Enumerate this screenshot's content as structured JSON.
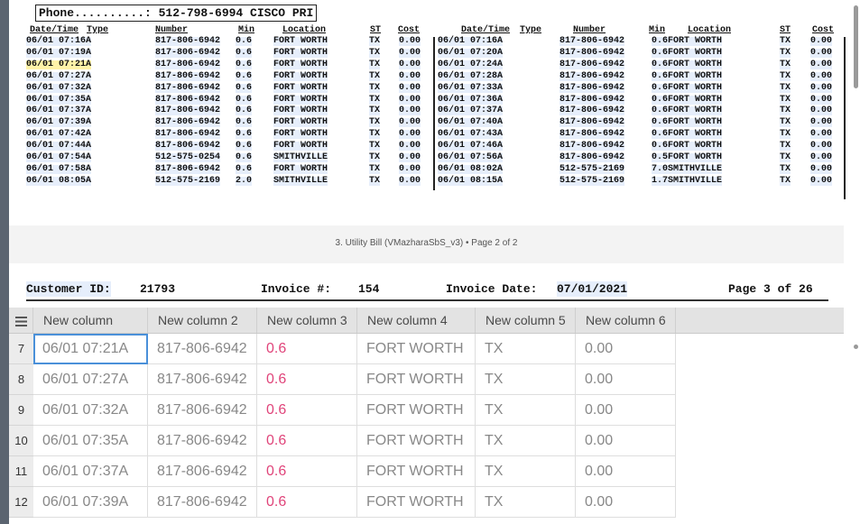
{
  "phone_label": "Phone..........: 512-798-6994 CISCO PRI",
  "headers": {
    "datetime": "Date/Time",
    "type": "Type",
    "number": "Number",
    "min": "Min",
    "location": "Location",
    "st": "ST",
    "cost": "Cost"
  },
  "calls_left": [
    [
      "06/01 07:16A",
      "817-806-6942",
      "0.6",
      "FORT WORTH",
      "TX",
      "0.00"
    ],
    [
      "06/01 07:19A",
      "817-806-6942",
      "0.6",
      "FORT WORTH",
      "TX",
      "0.00"
    ],
    [
      "06/01 07:21A",
      "817-806-6942",
      "0.6",
      "FORT WORTH",
      "TX",
      "0.00"
    ],
    [
      "06/01 07:27A",
      "817-806-6942",
      "0.6",
      "FORT WORTH",
      "TX",
      "0.00"
    ],
    [
      "06/01 07:32A",
      "817-806-6942",
      "0.6",
      "FORT WORTH",
      "TX",
      "0.00"
    ],
    [
      "06/01 07:35A",
      "817-806-6942",
      "0.6",
      "FORT WORTH",
      "TX",
      "0.00"
    ],
    [
      "06/01 07:37A",
      "817-806-6942",
      "0.6",
      "FORT WORTH",
      "TX",
      "0.00"
    ],
    [
      "06/01 07:39A",
      "817-806-6942",
      "0.6",
      "FORT WORTH",
      "TX",
      "0.00"
    ],
    [
      "06/01 07:42A",
      "817-806-6942",
      "0.6",
      "FORT WORTH",
      "TX",
      "0.00"
    ],
    [
      "06/01 07:44A",
      "817-806-6942",
      "0.6",
      "FORT WORTH",
      "TX",
      "0.00"
    ],
    [
      "06/01 07:54A",
      "512-575-0254",
      "0.6",
      "SMITHVILLE",
      "TX",
      "0.00"
    ],
    [
      "06/01 07:58A",
      "817-806-6942",
      "0.6",
      "FORT WORTH",
      "TX",
      "0.00"
    ],
    [
      "06/01 08:05A",
      "512-575-2169",
      "2.0",
      "SMITHVILLE",
      "TX",
      "0.00"
    ]
  ],
  "calls_right": [
    [
      "06/01 07:16A",
      "817-806-6942",
      "0.6",
      "FORT WORTH",
      "TX",
      "0.00"
    ],
    [
      "06/01 07:20A",
      "817-806-6942",
      "0.6",
      "FORT WORTH",
      "TX",
      "0.00"
    ],
    [
      "06/01 07:24A",
      "817-806-6942",
      "0.6",
      "FORT WORTH",
      "TX",
      "0.00"
    ],
    [
      "06/01 07:28A",
      "817-806-6942",
      "0.6",
      "FORT WORTH",
      "TX",
      "0.00"
    ],
    [
      "06/01 07:33A",
      "817-806-6942",
      "0.6",
      "FORT WORTH",
      "TX",
      "0.00"
    ],
    [
      "06/01 07:36A",
      "817-806-6942",
      "0.6",
      "FORT WORTH",
      "TX",
      "0.00"
    ],
    [
      "06/01 07:37A",
      "817-806-6942",
      "0.6",
      "FORT WORTH",
      "TX",
      "0.00"
    ],
    [
      "06/01 07:40A",
      "817-806-6942",
      "0.6",
      "FORT WORTH",
      "TX",
      "0.00"
    ],
    [
      "06/01 07:43A",
      "817-806-6942",
      "0.6",
      "FORT WORTH",
      "TX",
      "0.00"
    ],
    [
      "06/01 07:46A",
      "817-806-6942",
      "0.6",
      "FORT WORTH",
      "TX",
      "0.00"
    ],
    [
      "06/01 07:56A",
      "817-806-6942",
      "0.5",
      "FORT WORTH",
      "TX",
      "0.00"
    ],
    [
      "06/01 08:02A",
      "512-575-2169",
      "7.0",
      "SMITHVILLE",
      "TX",
      "0.00"
    ],
    [
      "06/01 08:15A",
      "512-575-2169",
      "1.7",
      "SMITHVILLE",
      "TX",
      "0.00"
    ]
  ],
  "highlighted_row": 2,
  "page_indicator": "3. Utility Bill (VMazharaSbS_v3) • Page 2 of 2",
  "page3": {
    "customer_label": "Customer ID:",
    "customer_id": "21793",
    "invoice_label": "Invoice #:",
    "invoice_no": "154",
    "invoice_date_label": "Invoice Date:",
    "invoice_date": "07/01/2021",
    "page_of": "Page 3 of 26"
  },
  "grid": {
    "menu_icon": "hamburger-icon",
    "columns": [
      "New column",
      "New column 2",
      "New column 3",
      "New column 4",
      "New column 5",
      "New column 6"
    ],
    "rows": [
      {
        "n": "7",
        "cells": [
          "06/01 07:21A",
          "817-806-6942",
          "0.6",
          "FORT WORTH",
          "TX",
          "0.00"
        ]
      },
      {
        "n": "8",
        "cells": [
          "06/01 07:27A",
          "817-806-6942",
          "0.6",
          "FORT WORTH",
          "TX",
          "0.00"
        ]
      },
      {
        "n": "9",
        "cells": [
          "06/01 07:32A",
          "817-806-6942",
          "0.6",
          "FORT WORTH",
          "TX",
          "0.00"
        ]
      },
      {
        "n": "10",
        "cells": [
          "06/01 07:35A",
          "817-806-6942",
          "0.6",
          "FORT WORTH",
          "TX",
          "0.00"
        ]
      },
      {
        "n": "11",
        "cells": [
          "06/01 07:37A",
          "817-806-6942",
          "0.6",
          "FORT WORTH",
          "TX",
          "0.00"
        ]
      },
      {
        "n": "12",
        "cells": [
          "06/01 07:39A",
          "817-806-6942",
          "0.6",
          "FORT WORTH",
          "TX",
          "0.00"
        ]
      }
    ],
    "selected_row": 0,
    "selected_col": 0
  },
  "colors": {
    "accent": "#4a90d9",
    "number_text": "#e0447a",
    "highlight": "#fff3a8"
  }
}
